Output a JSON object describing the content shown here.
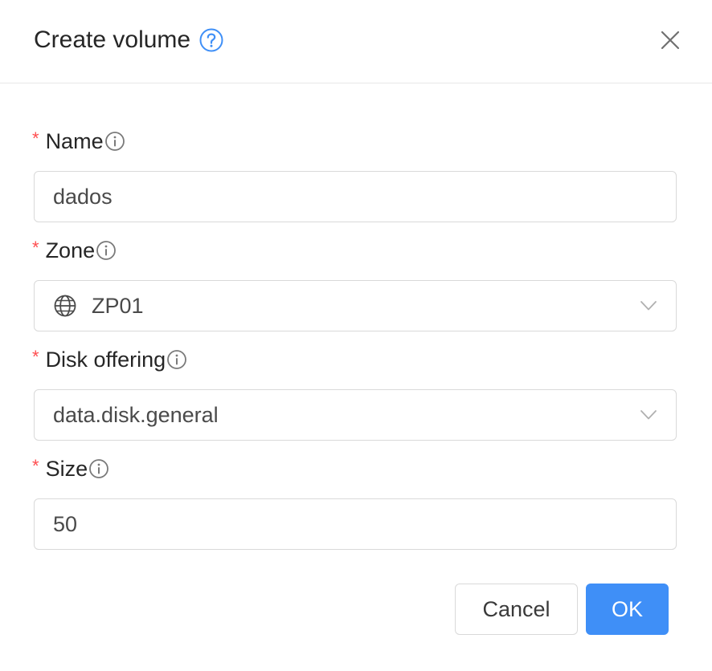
{
  "dialog": {
    "title": "Create volume",
    "icons": {
      "help": "question-circle-icon",
      "close": "close-icon"
    }
  },
  "fields": {
    "name": {
      "label": "Name",
      "required_mark": "*",
      "value": "dados",
      "info_icon": "info-circle-icon"
    },
    "zone": {
      "label": "Zone",
      "required_mark": "*",
      "value": "ZP01",
      "icon": "globe-icon",
      "info_icon": "info-circle-icon"
    },
    "disk_offering": {
      "label": "Disk offering",
      "required_mark": "*",
      "value": "data.disk.general",
      "info_icon": "info-circle-icon"
    },
    "size": {
      "label": "Size",
      "required_mark": "*",
      "value": "50",
      "info_icon": "info-circle-icon"
    }
  },
  "footer": {
    "cancel_label": "Cancel",
    "ok_label": "OK"
  },
  "colors": {
    "primary": "#3f8ff7",
    "required": "#ff4d4f",
    "border": "#d9d9d9",
    "text": "#262626"
  }
}
